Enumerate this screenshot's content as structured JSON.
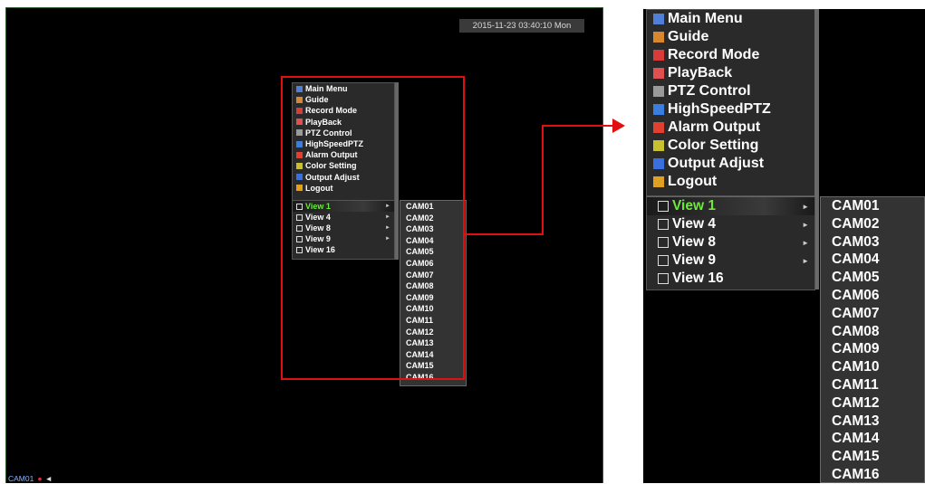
{
  "clock": "2015-11-23 03:40:10 Mon",
  "camera_overlay": {
    "label": "CAM01",
    "rec_symbol": "●",
    "speaker_symbol": "◄"
  },
  "main_menu": [
    {
      "label": "Main Menu",
      "icon": "main-menu-icon",
      "color": "#4f7fd6"
    },
    {
      "label": "Guide",
      "icon": "guide-icon",
      "color": "#d9872e"
    },
    {
      "label": "Record Mode",
      "icon": "record-mode-icon",
      "color": "#d93a3a"
    },
    {
      "label": "PlayBack",
      "icon": "playback-icon",
      "color": "#e05050"
    },
    {
      "label": "PTZ Control",
      "icon": "ptz-control-icon",
      "color": "#9a9a9a"
    },
    {
      "label": "HighSpeedPTZ",
      "icon": "highspeed-ptz-icon",
      "color": "#3a7fe0"
    },
    {
      "label": "Alarm Output",
      "icon": "alarm-output-icon",
      "color": "#e04030"
    },
    {
      "label": "Color Setting",
      "icon": "color-setting-icon",
      "color": "#c9c030"
    },
    {
      "label": "Output Adjust",
      "icon": "output-adjust-icon",
      "color": "#3a6fe0"
    },
    {
      "label": "Logout",
      "icon": "logout-icon",
      "color": "#e0a020"
    }
  ],
  "view_menu": [
    {
      "label": "View 1",
      "icon": "view-1-icon",
      "has_submenu": true,
      "active": true
    },
    {
      "label": "View 4",
      "icon": "view-4-icon",
      "has_submenu": true,
      "active": false
    },
    {
      "label": "View 8",
      "icon": "view-8-icon",
      "has_submenu": true,
      "active": false
    },
    {
      "label": "View 9",
      "icon": "view-9-icon",
      "has_submenu": true,
      "active": false
    },
    {
      "label": "View 16",
      "icon": "view-16-icon",
      "has_submenu": false,
      "active": false
    }
  ],
  "submenu_arrow": "►",
  "cameras": [
    "CAM01",
    "CAM02",
    "CAM03",
    "CAM04",
    "CAM05",
    "CAM06",
    "CAM07",
    "CAM08",
    "CAM09",
    "CAM10",
    "CAM11",
    "CAM12",
    "CAM13",
    "CAM14",
    "CAM15",
    "CAM16"
  ],
  "colors": {
    "highlight_text": "#6bea3a",
    "callout": "#e01010"
  }
}
